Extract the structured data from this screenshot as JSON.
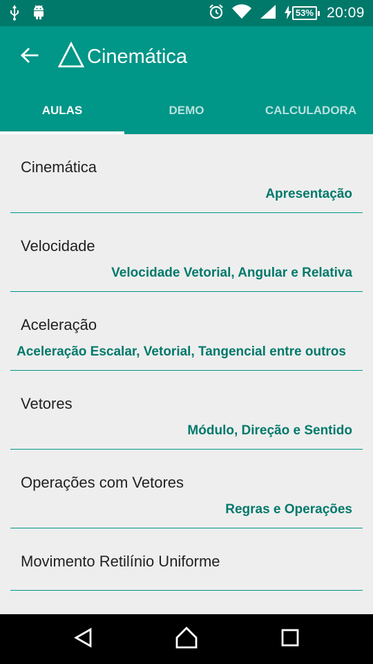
{
  "status_bar": {
    "battery_percent": "53%",
    "time": "20:09",
    "icons": [
      "usb-icon",
      "android-debug-icon",
      "alarm-icon",
      "wifi-icon",
      "cell-signal-icon",
      "charging-icon",
      "battery-icon"
    ]
  },
  "app_bar": {
    "title": "Cinemática",
    "back_icon": "arrow-back-icon",
    "logo_icon": "triangle-icon"
  },
  "tabs": [
    {
      "label": "AULAS",
      "active": true
    },
    {
      "label": "DEMO",
      "active": false
    },
    {
      "label": "CALCULADORA",
      "active": false
    }
  ],
  "lessons": [
    {
      "title": "Cinemática",
      "subtitle": "Apresentação"
    },
    {
      "title": "Velocidade",
      "subtitle": "Velocidade Vetorial, Angular e Relativa"
    },
    {
      "title": "Aceleração",
      "subtitle": "Aceleração Escalar, Vetorial, Tangencial entre outros"
    },
    {
      "title": "Vetores",
      "subtitle": "Módulo, Direção e Sentido"
    },
    {
      "title": "Operações com Vetores",
      "subtitle": "Regras e Operações"
    },
    {
      "title": "Movimento Retilínio Uniforme",
      "subtitle": ""
    }
  ],
  "colors": {
    "primary": "#009688",
    "primary_dark": "#00796b",
    "background": "#eeeeee"
  }
}
